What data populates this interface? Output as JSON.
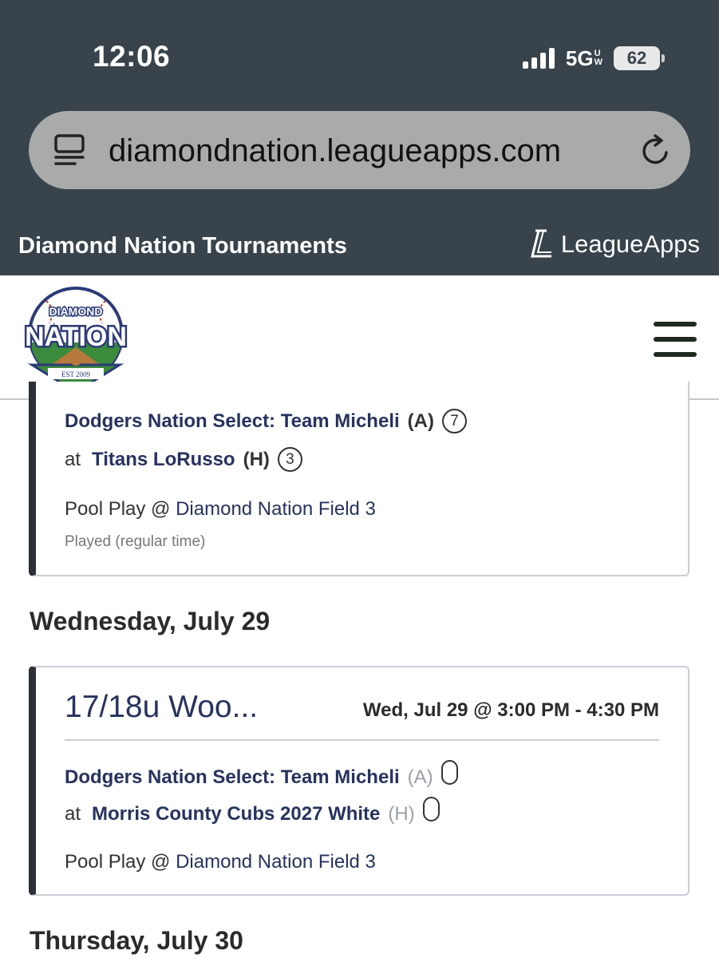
{
  "status_bar": {
    "time": "12:06",
    "network": "5G",
    "network_badge": [
      "U",
      "W"
    ],
    "battery": "62"
  },
  "browser": {
    "url": "diamondnation.leagueapps.com"
  },
  "site_bar": {
    "title": "Diamond Nation Tournaments",
    "brand": "LeagueApps"
  },
  "logo": {
    "top_text": "DIAMOND",
    "main_text": "NATION",
    "est_text": "EST 2009"
  },
  "games": [
    {
      "away_team": "Dodgers Nation Select: Team Micheli",
      "away_side": "(A)",
      "away_score": "7",
      "at_label": "at",
      "home_team": "Titans LoRusso",
      "home_side": "(H)",
      "home_score": "3",
      "venue_prefix": "Pool Play @",
      "venue": "Diamond Nation Field 3",
      "status": "Played (regular time)"
    },
    {
      "title": "17/18u Woo...",
      "time": "Wed, Jul 29 @ 3:00 PM - 4:30 PM",
      "away_team": "Dodgers Nation Select: Team Micheli",
      "away_side": "(A)",
      "at_label": "at",
      "home_team": "Morris County Cubs 2027 White",
      "home_side": "(H)",
      "venue_prefix": "Pool Play @",
      "venue": "Diamond Nation Field 3"
    }
  ],
  "day_headings": [
    "Wednesday, July 29",
    "Thursday, July 30"
  ],
  "colors": {
    "chrome_bg": "#38434b",
    "team_link": "#27325f",
    "card_accent": "#2c3037"
  }
}
